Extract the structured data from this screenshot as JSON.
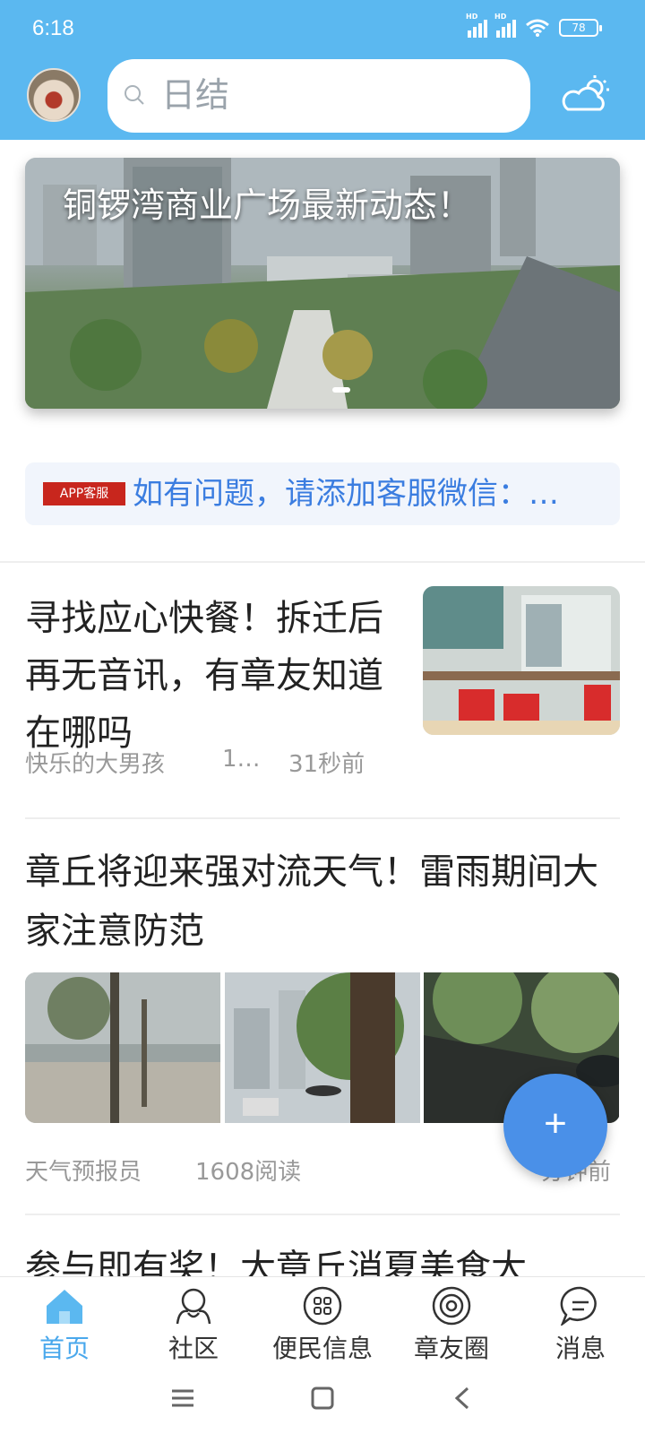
{
  "status_bar": {
    "time": "6:18",
    "battery": "78"
  },
  "search": {
    "placeholder": "日结"
  },
  "banner": {
    "title": "铜锣湾商业广场最新动态！"
  },
  "notice": {
    "badge": "APP客服",
    "text": "如有问题，请添加客服微信：…"
  },
  "articles": [
    {
      "title": "寻找应心快餐！拆迁后再无音讯，有章友知道在哪吗",
      "author": "快乐的大男孩",
      "reads": "1…",
      "time": "31秒前"
    },
    {
      "title": "章丘将迎来强对流天气！雷雨期间大家注意防范",
      "author": "天气预报员",
      "reads": "1608阅读",
      "time": "分钟前"
    },
    {
      "title": "参与即有奖！大章丘消夏美食大"
    }
  ],
  "fab": {
    "label": "+"
  },
  "tabs": [
    {
      "label": "首页",
      "icon": "home-icon",
      "active": true
    },
    {
      "label": "社区",
      "icon": "community-icon"
    },
    {
      "label": "便民信息",
      "icon": "grid-icon"
    },
    {
      "label": "章友圈",
      "icon": "circle-icon"
    },
    {
      "label": "消息",
      "icon": "message-icon"
    }
  ],
  "colors": {
    "header": "#5bb8f0",
    "accent": "#4aa8ec",
    "fab": "#4a90e8",
    "badge": "#c8261d",
    "notice_text": "#3b7de0"
  }
}
